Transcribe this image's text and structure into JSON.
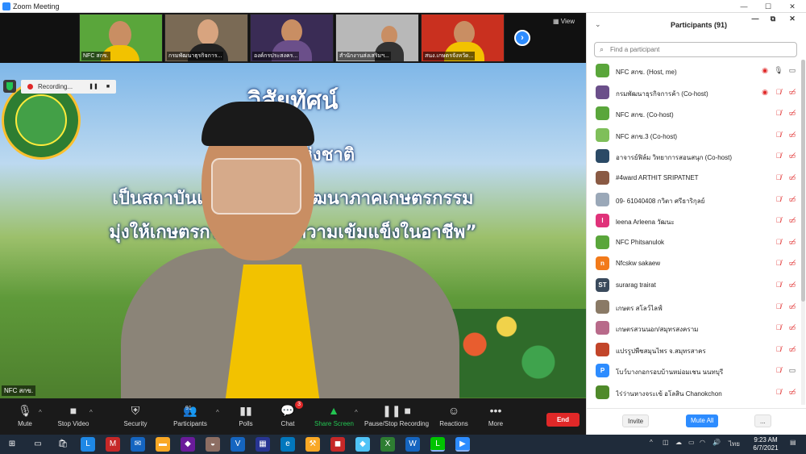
{
  "window": {
    "title": "Zoom Meeting",
    "controls": [
      "—",
      "☐",
      "✕"
    ]
  },
  "thumbnails": [
    {
      "label": "NFC สกข.",
      "colors": [
        "#5aa63b",
        "#f2c200"
      ]
    },
    {
      "label": "กรมพัฒนาธุรกิจการ...",
      "colors": [
        "#7a6a55",
        "#222"
      ]
    },
    {
      "label": "องค์กรประสงคร...",
      "colors": [
        "#6b4f8a",
        "#3a2c55"
      ]
    },
    {
      "label": "สำนักงานส่งเสริมฯ...",
      "colors": [
        "#b8b8b8",
        "#333"
      ]
    },
    {
      "label": "สนง.เกษตรจังหวัด...",
      "colors": [
        "#c9301f",
        "#f2c200"
      ]
    }
  ],
  "view_label": "View",
  "recording": {
    "label": "Recording...",
    "pause": "❚❚",
    "stop": "■"
  },
  "main_video": {
    "label": "NFC สกข.",
    "banner": {
      "title": "วิสัยทัศน์",
      "line1": "“ ...กรแห่งชาติ",
      "line2": "เป็นสถาบันแกนห... การพัฒนาภาคเกษตรกรรม",
      "line3": "มุ่งให้เกษตรกร และอ... ความเข้มแข็งในอาชีพ”"
    }
  },
  "toolbar": {
    "mute": "Mute",
    "stop_video": "Stop Video",
    "security": "Security",
    "participants": "Participants",
    "participants_count": "91",
    "polls": "Polls",
    "chat": "Chat",
    "chat_badge": "3",
    "share_screen": "Share Screen",
    "pause_stop_recording": "Pause/Stop Recording",
    "reactions": "Reactions",
    "more": "More",
    "end": "End"
  },
  "panel": {
    "title": "Participants (91)",
    "search_placeholder": "Find a participant",
    "participants": [
      {
        "name": "NFC สกข. (Host, me)",
        "avatar_color": "#5aa63b",
        "avatar_text": "",
        "rec": true,
        "mic": "on",
        "cam": "on"
      },
      {
        "name": "กรมพัฒนาธุรกิจการค้า (Co-host)",
        "avatar_color": "#6b4f8a",
        "avatar_text": "",
        "rec": true,
        "mic": "off",
        "cam": "off"
      },
      {
        "name": "NFC สกข. (Co-host)",
        "avatar_color": "#5aa63b",
        "avatar_text": "",
        "rec": false,
        "mic": "off",
        "cam": "off"
      },
      {
        "name": "NFC สกข.3 (Co-host)",
        "avatar_color": "#7fbf5a",
        "avatar_text": "",
        "rec": false,
        "mic": "off",
        "cam": "off"
      },
      {
        "name": "อาจารย์ฟิล์ม วิทยาการสอนสนุก (Co-host)",
        "avatar_color": "#2b4a66",
        "avatar_text": "",
        "rec": false,
        "mic": "off",
        "cam": "off"
      },
      {
        "name": "#4ward  ARTHIT SRIPATNET",
        "avatar_color": "#8a5a44",
        "avatar_text": "",
        "rec": false,
        "mic": "off",
        "cam": "off"
      },
      {
        "name": "09- 61040408 กวิตา ศรีธาริกุลย์",
        "avatar_color": "#9aa8b8",
        "avatar_text": "",
        "rec": false,
        "mic": "off",
        "cam": "off"
      },
      {
        "name": "leena Arleena วัฒนะ",
        "avatar_color": "#e0337a",
        "avatar_text": "l",
        "rec": false,
        "mic": "off",
        "cam": "off"
      },
      {
        "name": "NFC Phitsanulok",
        "avatar_color": "#5aa63b",
        "avatar_text": "",
        "rec": false,
        "mic": "off",
        "cam": "off"
      },
      {
        "name": "Nfcskw sakaew",
        "avatar_color": "#f27a1a",
        "avatar_text": "n",
        "rec": false,
        "mic": "off",
        "cam": "off"
      },
      {
        "name": "surarag trairat",
        "avatar_color": "#3a4a5c",
        "avatar_text": "ST",
        "rec": false,
        "mic": "off",
        "cam": "off"
      },
      {
        "name": "เกษตร สโลว์ไลฟ์",
        "avatar_color": "#8a7a66",
        "avatar_text": "",
        "rec": false,
        "mic": "off",
        "cam": "off"
      },
      {
        "name": "เกษตรสวนนอก/สมุทรสงคราม",
        "avatar_color": "#b86a8a",
        "avatar_text": "",
        "rec": false,
        "mic": "off",
        "cam": "off"
      },
      {
        "name": "แปรรูปพืชสมุนไพร จ.สมุทรสาคร",
        "avatar_color": "#c2452a",
        "avatar_text": "",
        "rec": false,
        "mic": "off",
        "cam": "off"
      },
      {
        "name": "โบว์บางกอกรอบบ้านหม่อมเชน นนทบุรี",
        "avatar_color": "#2d8cff",
        "avatar_text": "P",
        "rec": false,
        "mic": "off",
        "cam": "on"
      },
      {
        "name": "ไร่ว่านหางจระเข้ อโลสิน Chanokchon",
        "avatar_color": "#4f8a2a",
        "avatar_text": "",
        "rec": false,
        "mic": "off",
        "cam": "off"
      }
    ],
    "invite": "Invite",
    "mute_all": "Mute All",
    "more": "..."
  },
  "taskbar": {
    "clock_time": "9:23 AM",
    "clock_date": "6/7/2021",
    "lang": "ไทย",
    "apps": [
      {
        "name": "windows-start-icon",
        "glyph": "⊞",
        "color": "#1f2b3a"
      },
      {
        "name": "task-view-icon",
        "glyph": "▭",
        "color": "#1f2b3a"
      },
      {
        "name": "store-icon",
        "glyph": "🛍",
        "color": "#1f2b3a"
      },
      {
        "name": "app-l-icon",
        "glyph": "L",
        "color": "#1e88e5"
      },
      {
        "name": "mcafee-icon",
        "glyph": "M",
        "color": "#c62828"
      },
      {
        "name": "mail-icon",
        "glyph": "✉",
        "color": "#1565c0"
      },
      {
        "name": "file-explorer-icon",
        "glyph": "▬",
        "color": "#f9a825"
      },
      {
        "name": "visual-studio-icon",
        "glyph": "◆",
        "color": "#6a1b9a"
      },
      {
        "name": "paint-icon",
        "glyph": "◒",
        "color": "#8d6e63"
      },
      {
        "name": "word-v-icon",
        "glyph": "V",
        "color": "#1565c0"
      },
      {
        "name": "app-calendar-icon",
        "glyph": "▦",
        "color": "#283593"
      },
      {
        "name": "edge-icon",
        "glyph": "e",
        "color": "#0277bd"
      },
      {
        "name": "app-tools-icon",
        "glyph": "⚒",
        "color": "#f9a825"
      },
      {
        "name": "app-red-icon",
        "glyph": "◼",
        "color": "#c62828"
      },
      {
        "name": "app-blue-icon",
        "glyph": "◆",
        "color": "#4fc3f7"
      },
      {
        "name": "excel-icon",
        "glyph": "X",
        "color": "#2e7d32"
      },
      {
        "name": "word-icon",
        "glyph": "W",
        "color": "#1565c0"
      },
      {
        "name": "line-icon",
        "glyph": "L",
        "color": "#00c300"
      },
      {
        "name": "zoom-icon",
        "glyph": "▶",
        "color": "#2d8cff"
      }
    ]
  },
  "colors": {
    "accent": "#2d8cff",
    "danger": "#e02828",
    "share": "#23c552"
  }
}
